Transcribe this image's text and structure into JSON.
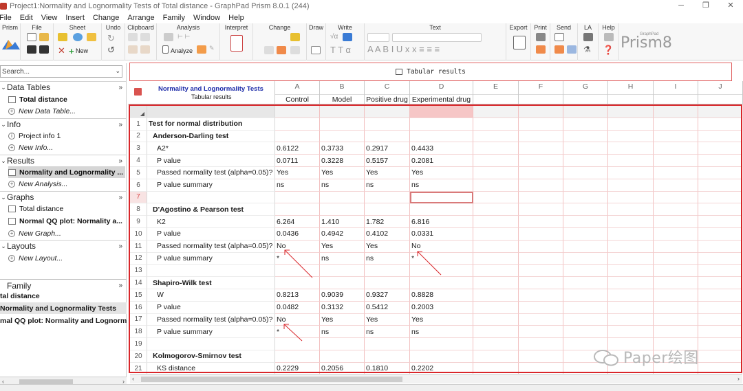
{
  "window": {
    "title": "Project1:Normality and Lognormality Tests of Total distance - GraphPad Prism 8.0.1 (244)",
    "controls": [
      "─",
      "❐",
      "✕"
    ]
  },
  "menu": [
    "File",
    "Edit",
    "View",
    "Insert",
    "Change",
    "Arrange",
    "Family",
    "Window",
    "Help"
  ],
  "ribbon": {
    "groups": [
      "Prism",
      "File",
      "Sheet",
      "Undo",
      "Clipboard",
      "Analysis",
      "Interpret",
      "Change",
      "Draw",
      "Write",
      "Text",
      "Export",
      "Print",
      "Send",
      "LA",
      "Help"
    ],
    "new_label": "New",
    "analyze_label": "Analyze",
    "logo_text": "Prism8",
    "logo_small": "GraphPad"
  },
  "navigator": {
    "search_placeholder": "Search...",
    "sections": [
      {
        "label": "Data Tables",
        "items": [
          {
            "label": "Total distance",
            "style": "bold"
          },
          {
            "label": "New Data Table...",
            "style": "italic"
          }
        ]
      },
      {
        "label": "Info",
        "items": [
          {
            "label": "Project info 1",
            "style": "normal"
          },
          {
            "label": "New Info...",
            "style": "italic"
          }
        ]
      },
      {
        "label": "Results",
        "items": [
          {
            "label": "Normality and Lognormality ...",
            "style": "bold selected"
          },
          {
            "label": "New Analysis...",
            "style": "italic"
          }
        ]
      },
      {
        "label": "Graphs",
        "items": [
          {
            "label": "Total distance",
            "style": "normal"
          },
          {
            "label": "Normal QQ plot: Normality a...",
            "style": "bold"
          },
          {
            "label": "New Graph...",
            "style": "italic"
          }
        ]
      },
      {
        "label": "Layouts",
        "items": [
          {
            "label": "New Layout...",
            "style": "italic"
          }
        ]
      }
    ],
    "family_label": "Family",
    "family_items": [
      "tal distance",
      "Normality and Lognormality Tests",
      "mal QQ plot: Normality and Lognorm"
    ]
  },
  "sheet_tab": "Tabular results",
  "table": {
    "title": "Normality and Lognormality Tests",
    "subtitle": "Tabular results",
    "columns": [
      {
        "letter": "A",
        "name": "Control"
      },
      {
        "letter": "B",
        "name": "Model"
      },
      {
        "letter": "C",
        "name": "Positive drug"
      },
      {
        "letter": "D",
        "name": "Experimental drug"
      },
      {
        "letter": "E",
        "name": ""
      },
      {
        "letter": "F",
        "name": ""
      },
      {
        "letter": "G",
        "name": ""
      },
      {
        "letter": "H",
        "name": ""
      },
      {
        "letter": "I",
        "name": ""
      },
      {
        "letter": "J",
        "name": ""
      }
    ],
    "rows": [
      {
        "n": "1",
        "title": "Test for normal distribution",
        "level": 0,
        "bold": true,
        "values": [
          "",
          "",
          "",
          ""
        ]
      },
      {
        "n": "2",
        "title": "Anderson-Darling test",
        "level": 1,
        "bold": true,
        "values": [
          "",
          "",
          "",
          ""
        ]
      },
      {
        "n": "3",
        "title": "A2*",
        "level": 2,
        "bold": false,
        "values": [
          "0.6122",
          "0.3733",
          "0.2917",
          "0.4433"
        ]
      },
      {
        "n": "4",
        "title": "P value",
        "level": 2,
        "bold": false,
        "values": [
          "0.0711",
          "0.3228",
          "0.5157",
          "0.2081"
        ]
      },
      {
        "n": "5",
        "title": "Passed normality test (alpha=0.05)?",
        "level": 2,
        "bold": false,
        "values": [
          "Yes",
          "Yes",
          "Yes",
          "Yes"
        ]
      },
      {
        "n": "6",
        "title": "P value summary",
        "level": 2,
        "bold": false,
        "values": [
          "ns",
          "ns",
          "ns",
          "ns"
        ]
      },
      {
        "n": "7",
        "title": "",
        "level": 0,
        "bold": false,
        "values": [
          "",
          "",
          "",
          ""
        ]
      },
      {
        "n": "8",
        "title": "D'Agostino & Pearson test",
        "level": 1,
        "bold": true,
        "values": [
          "",
          "",
          "",
          ""
        ]
      },
      {
        "n": "9",
        "title": "K2",
        "level": 2,
        "bold": false,
        "values": [
          "6.264",
          "1.410",
          "1.782",
          "6.816"
        ]
      },
      {
        "n": "10",
        "title": "P value",
        "level": 2,
        "bold": false,
        "values": [
          "0.0436",
          "0.4942",
          "0.4102",
          "0.0331"
        ]
      },
      {
        "n": "11",
        "title": "Passed normality test (alpha=0.05)?",
        "level": 2,
        "bold": false,
        "values": [
          "No",
          "Yes",
          "Yes",
          "No"
        ]
      },
      {
        "n": "12",
        "title": "P value summary",
        "level": 2,
        "bold": false,
        "values": [
          "*",
          "ns",
          "ns",
          "*"
        ]
      },
      {
        "n": "13",
        "title": "",
        "level": 0,
        "bold": false,
        "values": [
          "",
          "",
          "",
          ""
        ]
      },
      {
        "n": "14",
        "title": "Shapiro-Wilk test",
        "level": 1,
        "bold": true,
        "values": [
          "",
          "",
          "",
          ""
        ]
      },
      {
        "n": "15",
        "title": "W",
        "level": 2,
        "bold": false,
        "values": [
          "0.8213",
          "0.9039",
          "0.9327",
          "0.8828"
        ]
      },
      {
        "n": "16",
        "title": "P value",
        "level": 2,
        "bold": false,
        "values": [
          "0.0482",
          "0.3132",
          "0.5412",
          "0.2003"
        ]
      },
      {
        "n": "17",
        "title": "Passed normality test (alpha=0.05)?",
        "level": 2,
        "bold": false,
        "values": [
          "No",
          "Yes",
          "Yes",
          "Yes"
        ]
      },
      {
        "n": "18",
        "title": "P value summary",
        "level": 2,
        "bold": false,
        "values": [
          "*",
          "ns",
          "ns",
          "ns"
        ]
      },
      {
        "n": "19",
        "title": "",
        "level": 0,
        "bold": false,
        "values": [
          "",
          "",
          "",
          ""
        ]
      },
      {
        "n": "20",
        "title": "Kolmogorov-Smirnov test",
        "level": 1,
        "bold": true,
        "values": [
          "",
          "",
          "",
          ""
        ]
      },
      {
        "n": "21",
        "title": "KS distance",
        "level": 2,
        "bold": false,
        "values": [
          "0.2229",
          "0.2056",
          "0.1810",
          "0.2202"
        ]
      }
    ]
  },
  "watermark": "Paper绘图",
  "colors": {
    "title_blue": "#1c2ba8",
    "highlight_red": "#d9262a",
    "selected_pink": "#f6c6c6"
  }
}
